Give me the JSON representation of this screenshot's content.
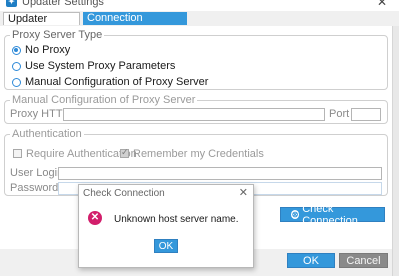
{
  "window": {
    "title": "Updater Settings",
    "close_glyph": "✕"
  },
  "tabs": [
    {
      "label": "Updater Settings",
      "active": true
    },
    {
      "label": "Connection Parameters",
      "active": false
    }
  ],
  "proxy_type": {
    "legend": "Proxy Server Type",
    "options": [
      {
        "label": "No Proxy",
        "selected": true
      },
      {
        "label": "Use System Proxy Parameters",
        "selected": false
      },
      {
        "label": "Manual Configuration of Proxy Server",
        "selected": false
      }
    ]
  },
  "manual_config": {
    "legend": "Manual Configuration of Proxy Server",
    "proxy_label": "Proxy HTTP",
    "proxy_value": "",
    "port_label": "Port",
    "port_value": ""
  },
  "authentication": {
    "legend": "Authentication",
    "require_auth_label": "Require Authentication",
    "require_auth_checked": false,
    "remember_label": "Remember my Credentials",
    "remember_checked": true,
    "login_label": "User Login",
    "login_value": "",
    "password_label": "Password",
    "password_value": ""
  },
  "check_connection_button": "Check Connection",
  "footer": {
    "ok_label": "OK",
    "cancel_label": "Cancel"
  },
  "dialog": {
    "title": "Check Connection",
    "close_glyph": "✕",
    "message": "Unknown host server name.",
    "ok_label": "OK"
  },
  "colors": {
    "accent": "#3498db",
    "error": "#d21e6b",
    "cancel": "#8a8a8a"
  }
}
